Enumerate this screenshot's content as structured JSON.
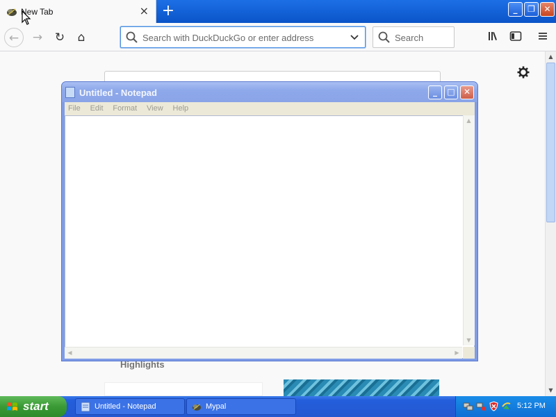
{
  "browser": {
    "tab": {
      "title": "New Tab",
      "close": "×"
    },
    "new_tab": "+",
    "window_buttons": {
      "minimize": "_",
      "maximize": "❐",
      "close": "✕"
    },
    "urlbar": {
      "placeholder": "Search with DuckDuckGo or enter address"
    },
    "searchbar": {
      "placeholder": "Search"
    },
    "nav": {
      "back": "←",
      "forward": "→",
      "reload": "↻",
      "home": "⌂"
    },
    "toolbar": {
      "library": "|||\\",
      "sidebar": "◫",
      "menu": "☰"
    }
  },
  "page": {
    "settings": "⚙",
    "highlights_heading": "Highlights"
  },
  "notepad": {
    "title": "Untitled - Notepad",
    "menu": [
      "File",
      "Edit",
      "Format",
      "View",
      "Help"
    ],
    "buttons": {
      "minimize": "_",
      "maximize": "□",
      "close": "✕"
    },
    "content": ""
  },
  "taskbar": {
    "start_label": "start",
    "tasks": [
      {
        "label": "Untitled - Notepad",
        "icon": "notepad-icon"
      },
      {
        "label": "Mypal",
        "icon": "mypal-icon"
      }
    ],
    "clock": "5:12 PM"
  },
  "colors": {
    "taskbar": "#245edb",
    "start_green": "#3a9a34",
    "browser_titlebar": "#0a54c8",
    "notepad_titlebar_inactive": "#8ea9ea",
    "urlbar_focus": "#4a90e2"
  }
}
